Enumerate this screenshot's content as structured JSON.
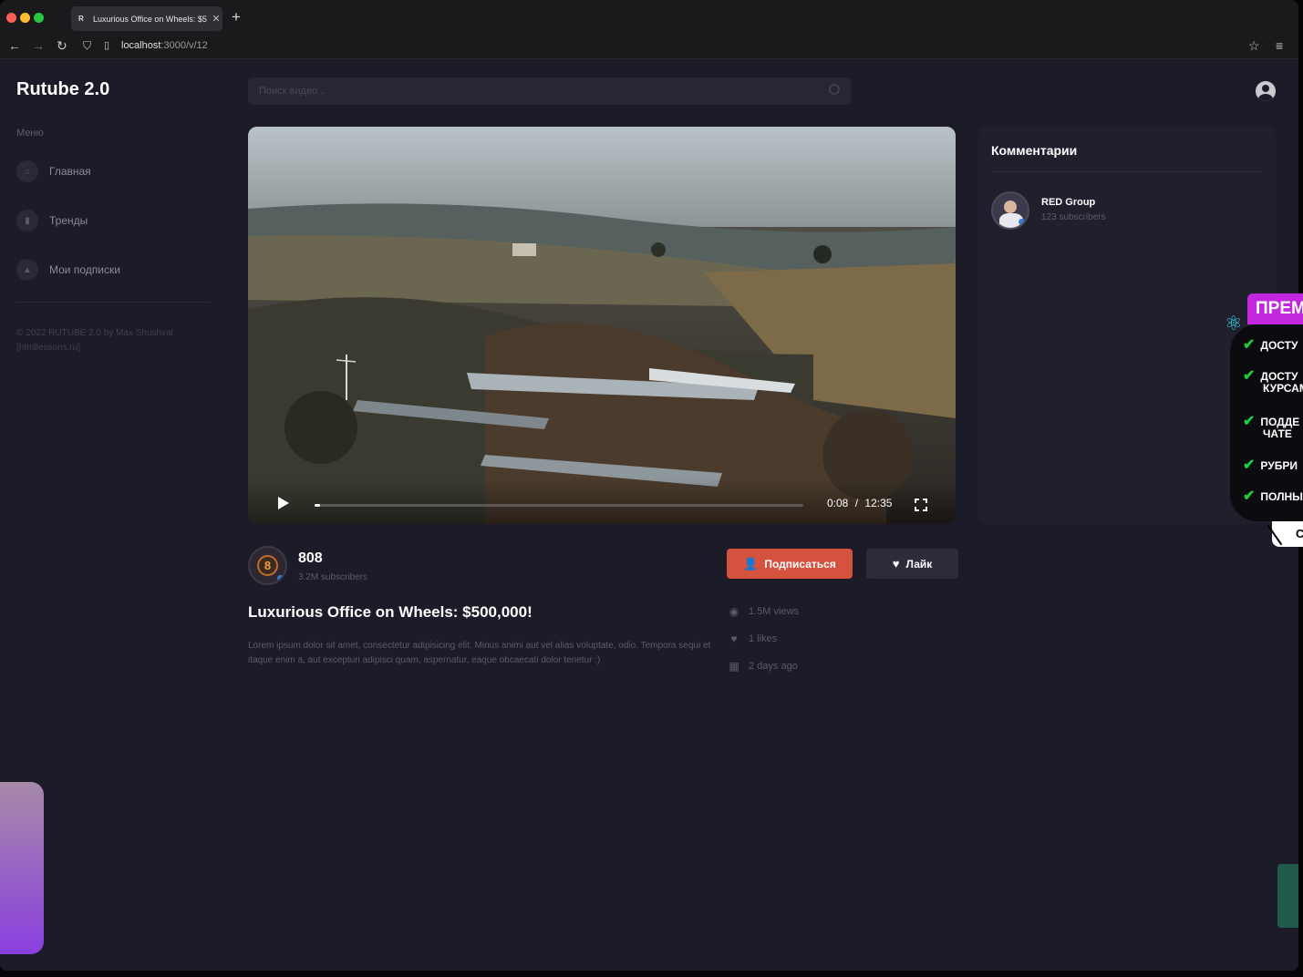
{
  "browser": {
    "tab_title": "Luxurious Office on Wheels: $5",
    "url_host": "localhost",
    "url_path": ":3000/v/12"
  },
  "sidebar": {
    "logo": "Rutube 2.0",
    "menu_title": "Меню",
    "items": [
      {
        "label": "Главная",
        "icon": "home-icon"
      },
      {
        "label": "Тренды",
        "icon": "chart-icon"
      },
      {
        "label": "Мои подписки",
        "icon": "bell-icon"
      }
    ],
    "copyright": "© 2022 RUTUBE 2.0 by Max Shushval [htmllessons.ru]"
  },
  "search": {
    "placeholder": "Поиск видео..."
  },
  "player": {
    "current_time": "0:08",
    "separator": "/",
    "duration": "12:35",
    "progress_fraction": 0.011
  },
  "channel": {
    "name": "808",
    "subscribers": "3.2M subscribers",
    "avatar_char": "8"
  },
  "actions": {
    "subscribe_label": "Подписаться",
    "like_label": "Лайк"
  },
  "video": {
    "title": "Luxurious Office on Wheels: $500,000!",
    "description": "Lorem ipsum dolor sit amet, consectetur adipisicing elit. Minus animi aut vel alias voluptate, odio. Tempora sequi et itaque enim a, aut excepturi adipisci quam, aspernatur, eaque obcaecati dolor tenetur :)",
    "views": "1.5M views",
    "likes": "1 likes",
    "date": "2 days ago"
  },
  "comments": {
    "title": "Комментарии",
    "user_name": "RED Group",
    "user_subs": "123 subscribers"
  },
  "promo": {
    "banner": "ПРЕМИ",
    "rows": [
      "ДОСТУ",
      "ДОСТУ КУРСАМ",
      "ПОДДЕ ЧАТЕ",
      "РУБРИ",
      "ПОЛНЫ"
    ],
    "tag": "СО"
  },
  "colors": {
    "background": "#1c1c28",
    "accent": "#d4523e",
    "promo_purple": "#c227e0",
    "check_green": "#1fcb3a"
  }
}
